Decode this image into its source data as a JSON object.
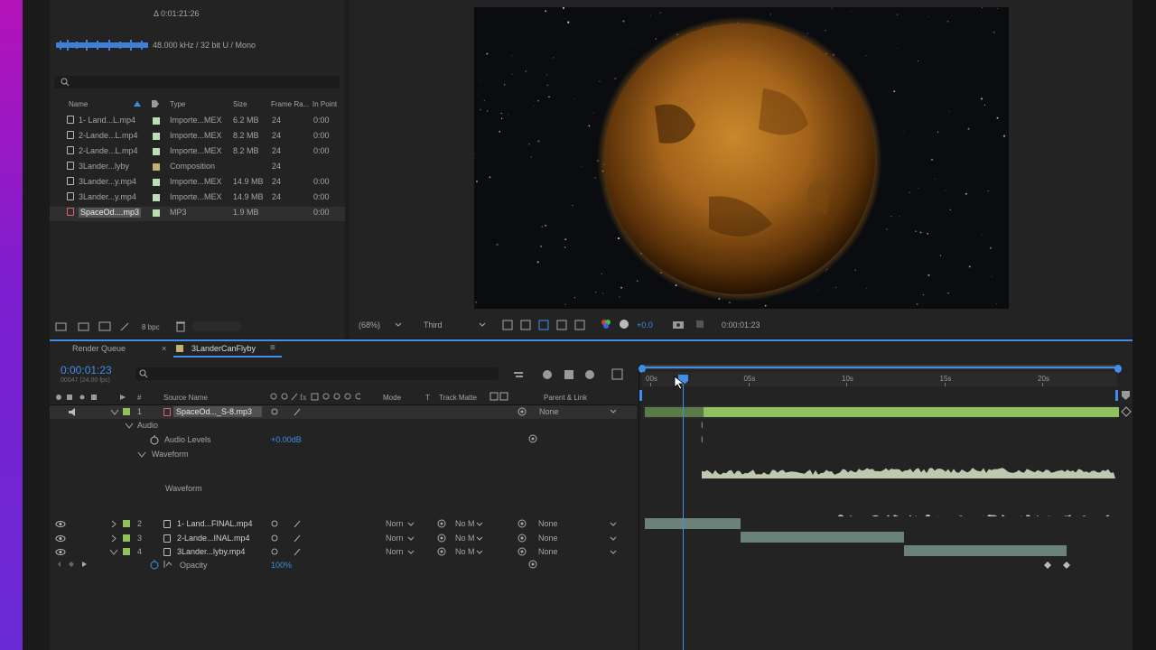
{
  "colors": {
    "accent": "#3f8fe8",
    "audio_track": "#8fc15e",
    "footage_track": "#6a827a",
    "waveform": "#cfdcc0"
  },
  "project": {
    "duration": "Δ 0:01:21:26",
    "audio_info": "48.000 kHz / 32 bit U / Mono",
    "columns": [
      "Name",
      "Type",
      "Size",
      "Frame Ra...",
      "In Point"
    ],
    "items": [
      {
        "name": "1- Land...L.mp4",
        "type": "Importe...MEX",
        "size": "6.2 MB",
        "fps": "24",
        "in": "0:00",
        "color": "#b8e0b0",
        "icon": "footage-icon"
      },
      {
        "name": "2-Lande...L.mp4",
        "type": "Importe...MEX",
        "size": "8.2 MB",
        "fps": "24",
        "in": "0:00",
        "color": "#b8e0b0",
        "icon": "footage-icon"
      },
      {
        "name": "2-Lande...L.mp4",
        "type": "Importe...MEX",
        "size": "8.2 MB",
        "fps": "24",
        "in": "0:00",
        "color": "#b8e0b0",
        "icon": "footage-icon"
      },
      {
        "name": "3Lander...lyby",
        "type": "Composition",
        "size": "",
        "fps": "24",
        "in": "",
        "color": "#c8b070",
        "icon": "composition-icon"
      },
      {
        "name": "3Lander...y.mp4",
        "type": "Importe...MEX",
        "size": "14.9 MB",
        "fps": "24",
        "in": "0:00",
        "color": "#b8e0b0",
        "icon": "footage-icon"
      },
      {
        "name": "3Lander...y.mp4",
        "type": "Importe...MEX",
        "size": "14.9 MB",
        "fps": "24",
        "in": "0:00",
        "color": "#b8e0b0",
        "icon": "footage-icon"
      },
      {
        "name": "SpaceOd....mp3",
        "type": "MP3",
        "size": "1.9 MB",
        "fps": "",
        "in": "0:00",
        "color": "#b8e0b0",
        "icon": "audio-file-icon",
        "selected": true
      }
    ],
    "bpc": "8 bpc"
  },
  "viewer": {
    "zoom": "(68%)",
    "resolution": "Third",
    "exposure": "+0.0",
    "timecode": "0:00:01:23"
  },
  "tabs": [
    {
      "label": "Render Queue"
    },
    {
      "label": "3LanderCanFlyby",
      "active": true
    }
  ],
  "timeline": {
    "timecode": "0:00:01:23",
    "fps_info": "00047 (24.00 fps)",
    "col_source": "Source Name",
    "col_mode": "Mode",
    "col_t": "T",
    "col_matte": "Track Matte",
    "col_parent": "Parent & Link",
    "ruler": [
      "00s",
      "05s",
      "10s",
      "15s",
      "20s"
    ],
    "layers": [
      {
        "num": "1",
        "name": "SpaceOd..._S-8.mp3",
        "mode": "",
        "matte": "",
        "parent": "None",
        "color": "#8fc15e",
        "selected": true
      },
      {
        "num": "2",
        "name": "1- Land...FINAL.mp4",
        "mode": "Norn",
        "matte": "No M",
        "parent": "None",
        "color": "#8fc15e"
      },
      {
        "num": "3",
        "name": "2-Lande...INAL.mp4",
        "mode": "Norn",
        "matte": "No M",
        "parent": "None",
        "color": "#8fc15e"
      },
      {
        "num": "4",
        "name": "3Lander...lyby.mp4",
        "mode": "Norn",
        "matte": "No M",
        "parent": "None",
        "color": "#8fc15e"
      }
    ],
    "audio_group": "Audio",
    "audio_levels_label": "Audio Levels",
    "audio_levels_value": "+0.00dB",
    "waveform_group": "Waveform",
    "waveform_label": "Waveform",
    "opacity_label": "Opacity",
    "opacity_value": "100%"
  }
}
